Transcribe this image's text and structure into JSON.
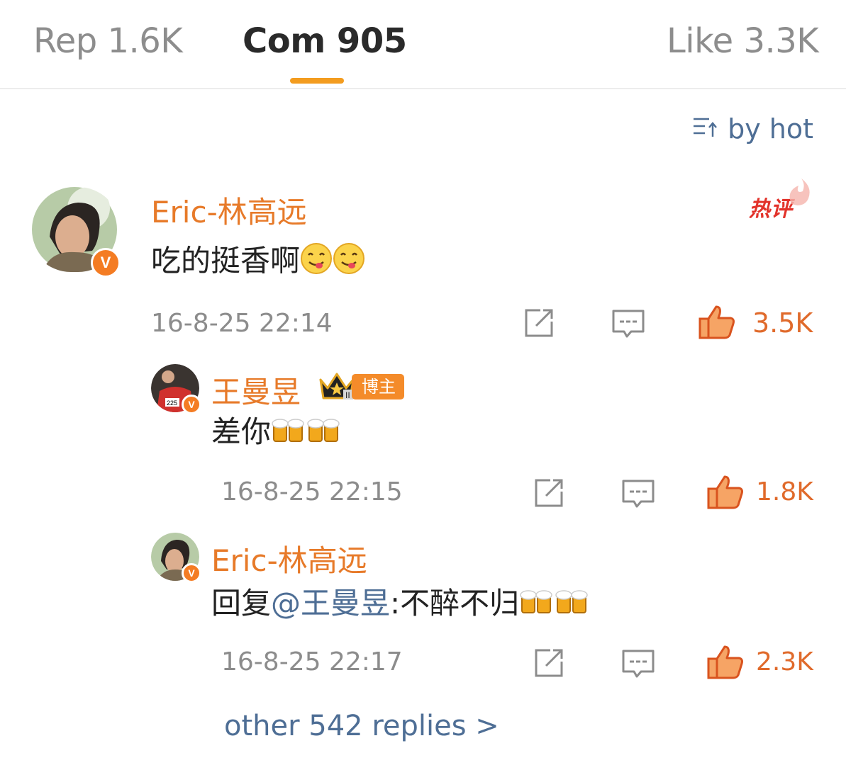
{
  "tabs": [
    {
      "label": "Rep 1.6K"
    },
    {
      "label": "Com 905",
      "active": true
    },
    {
      "label": "Like 3.3K"
    }
  ],
  "sort": {
    "label": "by hot",
    "icon": "sort-icon"
  },
  "accent_color": "#f39c1f",
  "comment": {
    "author": "Eric-林高远",
    "verified": "V",
    "hot_tag": "热评",
    "text": "吃的挺香啊",
    "emojis": [
      "yum-emoji",
      "yum-emoji"
    ],
    "time": "16-8-25 22:14",
    "likes": "3.5K"
  },
  "replies": [
    {
      "author": "王曼昱",
      "verified": "V",
      "badge": "博主",
      "text": "差你",
      "emojis": [
        "beer-emoji",
        "beer-emoji"
      ],
      "time": "16-8-25 22:15",
      "likes": "1.8K"
    },
    {
      "author": "Eric-林高远",
      "verified": "V",
      "reply_prefix": "回复",
      "mention": "@王曼昱",
      "text": ":不醉不归",
      "emojis": [
        "beer-emoji",
        "beer-emoji"
      ],
      "time": "16-8-25 22:17",
      "likes": "2.3K"
    }
  ],
  "more_replies": "other 542 replies >"
}
